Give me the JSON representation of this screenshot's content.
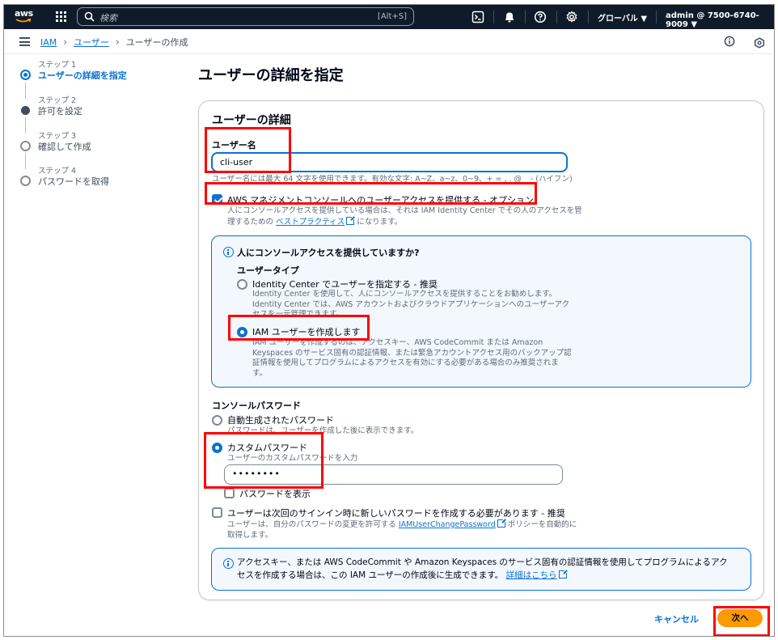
{
  "topnav": {
    "logo": "aws",
    "search_placeholder": "検索",
    "search_shortcut": "[Alt+S]",
    "region": "グローバル ▼",
    "account": "admin @ 7500-6740-9009 ▼",
    "icons": [
      "cloudshell-icon",
      "bell-icon",
      "help-icon",
      "gear-icon"
    ]
  },
  "breadcrumb": {
    "items": [
      "IAM",
      "ユーザー",
      "ユーザーの作成"
    ]
  },
  "steps": [
    {
      "label": "ステップ 1",
      "name": "ユーザーの詳細を指定",
      "state": "active"
    },
    {
      "label": "ステップ 2",
      "name": "許可を設定",
      "state": "filled"
    },
    {
      "label": "ステップ 3",
      "name": "確認して作成",
      "state": "empty"
    },
    {
      "label": "ステップ 4",
      "name": "パスワードを取得",
      "state": "empty"
    }
  ],
  "page_title": "ユーザーの詳細を指定",
  "details": {
    "heading": "ユーザーの詳細",
    "username_label": "ユーザー名",
    "username_value": "cli-user",
    "username_hint": "ユーザー名には最大 64 文字を使用できます。有効な文字: A~Z、a~z、0~9、+ = , . @ _ - (ハイフン)",
    "console_access_label": "AWS マネジメントコンソールへのユーザーアクセスを提供する - オプション",
    "console_access_checked": true,
    "console_access_desc_1": "人にコンソールアクセスを提供している場合は、それは IAM Identity Center でその人のアクセスを管",
    "console_access_desc_2": "理するための",
    "console_access_link": "ベストプラクティス",
    "console_access_desc_3": "になります。"
  },
  "access_info": {
    "question": "人にコンソールアクセスを提供していますか?",
    "user_type_label": "ユーザータイプ",
    "option_ic_label": "Identity Center でユーザーを指定する - 推奨",
    "option_ic_desc_1": "Identity Center を使用して、人にコンソールアクセスを提供することをお勧めします。",
    "option_ic_desc_2": "Identity Center では、AWS アカウントおよびクラウドアプリケーションへのユーザーアク",
    "option_ic_desc_3": "セスを一元管理できます。",
    "option_iam_label": "IAM ユーザーを作成します",
    "option_iam_desc_1": "IAM ユーザーを作成するのは、アクセスキー、AWS CodeCommit または Amazon",
    "option_iam_desc_2": "Keyspaces のサービス固有の認証情報、または緊急アカウントアクセス用のバックアップ認",
    "option_iam_desc_3": "証情報を使用してプログラムによるアクセスを有効にする必要がある場合のみ推奨されま",
    "option_iam_desc_4": "す。",
    "selected": "iam"
  },
  "password": {
    "label": "コンソールパスワード",
    "auto_label": "自動生成されたパスワード",
    "auto_desc": "パスワードは、ユーザーを作成した後に表示できます。",
    "custom_label": "カスタムパスワード",
    "custom_desc": "ユーザーのカスタムパスワードを入力",
    "custom_value": "••••••••",
    "selected": "custom",
    "show_label": "パスワードを表示",
    "show_checked": false,
    "reset_label": "ユーザーは次回のサインイン時に新しいパスワードを作成する必要があります - 推奨",
    "reset_checked": false,
    "reset_desc_1": "ユーザーは、自分のパスワードの変更を許可する",
    "reset_link": "IAMUserChangePassword",
    "reset_desc_2": "ポリシーを自動的に",
    "reset_desc_3": "取得します。"
  },
  "bottom_info": {
    "text_1": "アクセスキー、または AWS CodeCommit や Amazon Keyspaces のサービス固有の認証情報を使用してプログラムによるアク",
    "text_2": "セスを作成する場合は、この IAM ユーザーの作成後に生成できます。",
    "link": "詳細はこちら"
  },
  "footer": {
    "cancel_label": "キャンセル",
    "next_label": "次へ"
  },
  "colors": {
    "accent": "#0972d3",
    "primary_button": "#ff9900",
    "highlight_box": "#ff0000",
    "topnav": "#0f1b2a"
  }
}
